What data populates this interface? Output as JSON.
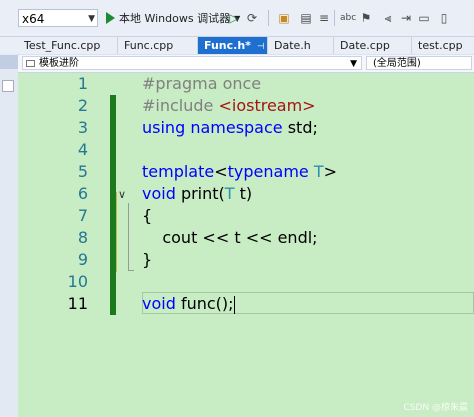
{
  "toolbar": {
    "platform": "x64",
    "run_label": "本地 Windows 调试器"
  },
  "tabs": [
    {
      "label": "Test_Func.cpp"
    },
    {
      "label": "Func.cpp"
    },
    {
      "label": "Func.h*"
    },
    {
      "label": "Date.h"
    },
    {
      "label": "Date.cpp"
    },
    {
      "label": "test.cpp"
    }
  ],
  "navbar": {
    "scope": "模板进阶",
    "context": "(全局范围)"
  },
  "editor": {
    "lines": [
      {
        "n": "1"
      },
      {
        "n": "2"
      },
      {
        "n": "3"
      },
      {
        "n": "4"
      },
      {
        "n": "5"
      },
      {
        "n": "6"
      },
      {
        "n": "7"
      },
      {
        "n": "8"
      },
      {
        "n": "9"
      },
      {
        "n": "10"
      },
      {
        "n": "11"
      }
    ],
    "code": {
      "l1": "#pragma once",
      "l2_pp": "#include ",
      "l2_str": "<iostream>",
      "l3_kw1": "using",
      "l3_kw2": "namespace",
      "l3_rest": " std;",
      "l5_kw1": "template",
      "l5_a": "<",
      "l5_kw2": "typename",
      "l5_t": " T",
      "l5_b": ">",
      "l6_kw": "void",
      "l6_a": " print(",
      "l6_t": "T",
      "l6_b": " t)",
      "l7": "{",
      "l8": "    cout << t << endl;",
      "l9": "}",
      "l11_kw": "void",
      "l11_rest": " func();"
    }
  },
  "watermark": "CSDN @椋朱晨",
  "colors": {
    "editor_bg": "#c8ecc4",
    "keyword": "#0000ff",
    "preprocessor": "#808080",
    "string": "#a31515",
    "type": "#2b91af",
    "line_number": "#237893",
    "active_tab": "#1f6fd1",
    "change_bar": "#1b7a1b"
  }
}
